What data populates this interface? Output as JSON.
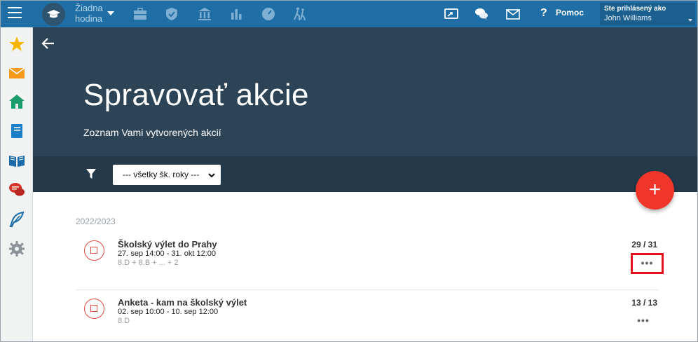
{
  "topbar": {
    "hodina_label": "Žiadna hodina",
    "help_label": "Pomoc",
    "help_glyph": "?",
    "login_prefix": "Ste prihlásený ako",
    "user_name": "John Williams",
    "accent_color": "#1f6fa6"
  },
  "sidebar": {
    "items": [
      {
        "icon": "star-icon"
      },
      {
        "icon": "mail-icon"
      },
      {
        "icon": "home-icon"
      },
      {
        "icon": "notebook-icon"
      },
      {
        "icon": "book-icon"
      },
      {
        "icon": "chat-icon"
      },
      {
        "icon": "feather-icon"
      },
      {
        "icon": "gear-icon"
      }
    ]
  },
  "header": {
    "title": "Spravovať akcie",
    "subtitle": "Zoznam Vami vytvorených akcií"
  },
  "filter": {
    "selected": "--- všetky šk. roky ---"
  },
  "fab": {
    "label": "+"
  },
  "content": {
    "year": "2022/2023",
    "events": [
      {
        "title": "Školský výlet do Prahy",
        "dates": "27. sep 14:00 - 31. okt 12:00",
        "classes": "8.D + 8.B + ... + 2",
        "count": "29 / 31",
        "more": "•••"
      },
      {
        "title": "Anketa - kam na školský výlet",
        "dates": "02. sep 10:00 - 10. sep 12:00",
        "classes": "8.D",
        "count": "13 / 13",
        "more": "•••"
      }
    ]
  }
}
